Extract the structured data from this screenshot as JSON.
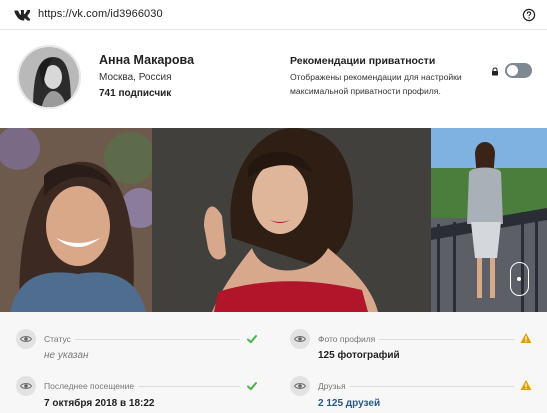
{
  "browser": {
    "url": "https://vk.com/id3966030"
  },
  "profile": {
    "name": "Анна Макарова",
    "city": "Москва, Россия",
    "subscribers": "741 подписчик"
  },
  "privacy": {
    "title": "Рекомендации приватности",
    "description": "Отображены рекомендации для настройки максимальной приватности профиля.",
    "toggle_on": false
  },
  "info": {
    "status": {
      "label": "Статус",
      "value": "не указан",
      "check": "ok"
    },
    "last_seen": {
      "label": "Последнее посещение",
      "value": "7 октября 2018 в 18:22",
      "check": "ok"
    },
    "photos": {
      "label": "Фото профиля",
      "value": "125 фотографий",
      "check": "warning"
    },
    "friends": {
      "label": "Друзья",
      "value": "2 125 друзей",
      "check": "warning"
    }
  },
  "colors": {
    "ok": "#4bb34b",
    "warning": "#e0a100",
    "link": "#2a5885",
    "toggle_off": "#7d8891"
  },
  "icons": [
    "vk-logo-icon",
    "help-circle-icon",
    "lock-icon",
    "eye-icon",
    "check-icon",
    "warning-icon"
  ]
}
